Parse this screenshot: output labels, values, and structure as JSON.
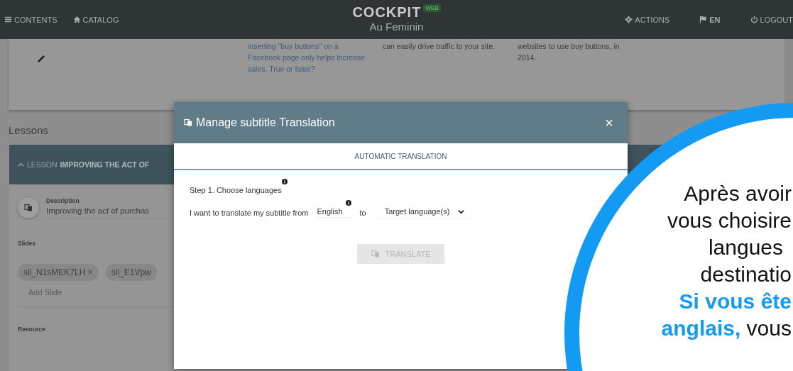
{
  "navbar": {
    "left": [
      {
        "label": "CONTENTS"
      },
      {
        "label": "CATALOG"
      }
    ],
    "logo": {
      "name": "COCKPIT",
      "badge": "WEB",
      "subtitle": "Au Feminin"
    },
    "right": [
      {
        "label": "ACTIONS",
        "bold": false
      },
      {
        "label": "EN",
        "bold": true
      },
      {
        "label": "LOGOUT",
        "bold": false
      }
    ]
  },
  "question_card": {
    "columns": [
      {
        "text": "inserting \"buy buttons\" on a Facebook page only helps increase sales. True or false?",
        "kind": "link"
      },
      {
        "text": "can easily drive traffic to your site.",
        "kind": "plain"
      },
      {
        "text": "websites to use buy buttons, in 2014.",
        "kind": "plain"
      }
    ]
  },
  "lessons": {
    "heading": "Lessons",
    "lesson": {
      "prefix": "LESSON",
      "title": "IMPROVING THE ACT OF",
      "expanded": true,
      "description_label": "Description",
      "description": "Improving the act of purchas",
      "slides_label": "Slides",
      "slides": [
        {
          "label": "sli_N1sMEK7LH",
          "remove": "×"
        },
        {
          "label": "sli_E1Vpw"
        }
      ],
      "add_slide": "Add Slide",
      "resource_label": "Resource"
    }
  },
  "modal": {
    "title": "Manage subtitle Translation",
    "close": "×",
    "tabs": [
      {
        "label": "AUTOMATIC TRANSLATION",
        "selected": true
      }
    ],
    "step": "Step 1. Choose languages",
    "sentence": "I want to translate my subtitle from",
    "source": "English",
    "to": "to",
    "target_placeholder": "Target language(s)",
    "button": {
      "label": "TRANSLATE",
      "disabled": true
    }
  },
  "callout": {
    "lines": [
      "Après avoir",
      "vous choisire",
      "langues",
      "destinatio",
      "**Si vous ête**",
      "**anglais,** vous"
    ]
  }
}
